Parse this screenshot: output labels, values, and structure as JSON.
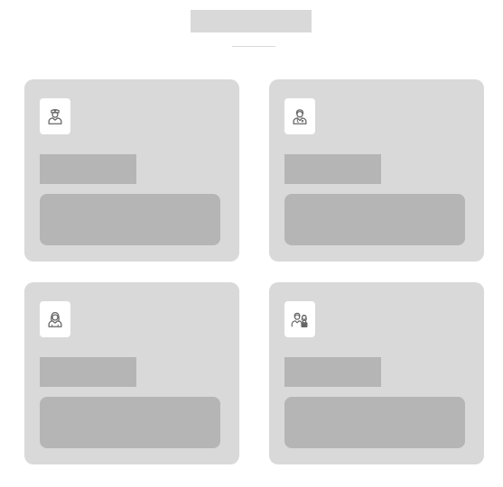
{
  "header": {
    "title": ""
  },
  "cards": [
    {
      "icon": "nurse-icon",
      "title": "",
      "description": ""
    },
    {
      "icon": "doctor-icon",
      "title": "",
      "description": ""
    },
    {
      "icon": "female-user-icon",
      "title": "",
      "description": ""
    },
    {
      "icon": "group-lock-icon",
      "title": "",
      "description": ""
    }
  ],
  "colors": {
    "card_background": "#d9d9d9",
    "placeholder_block": "#b5b5b5",
    "icon_tile": "#ffffff",
    "icon_stroke": "#666666"
  }
}
